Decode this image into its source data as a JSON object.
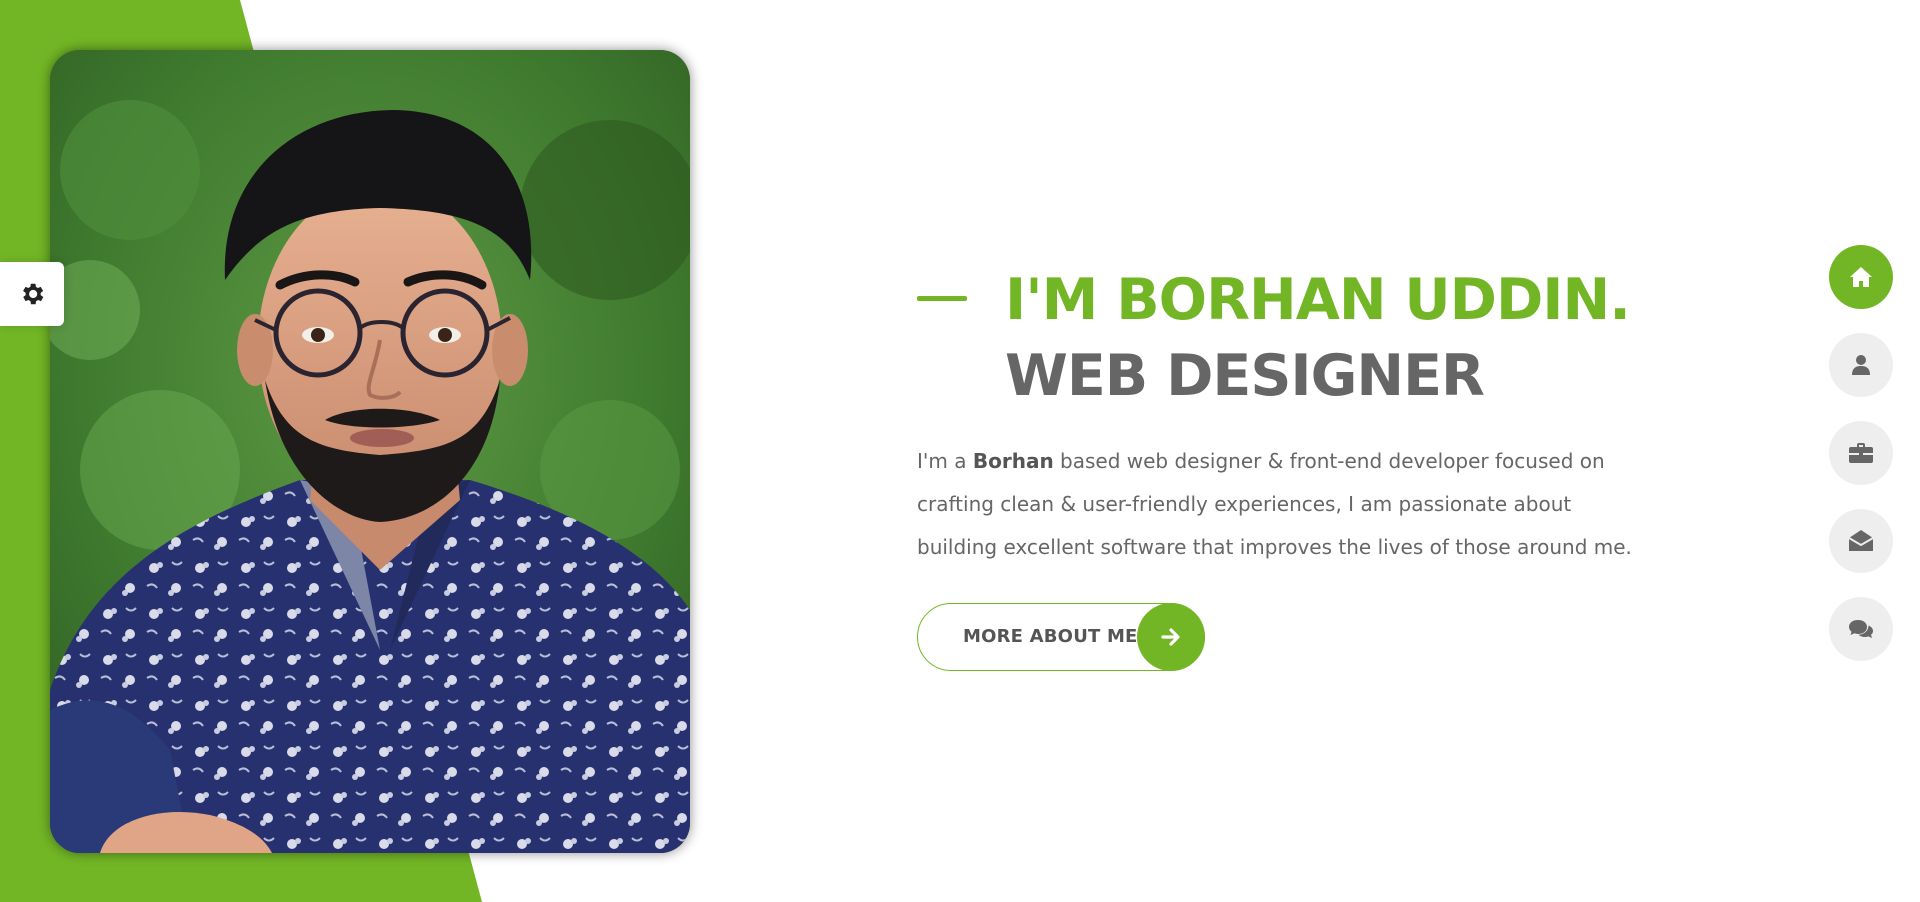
{
  "theme": {
    "accent": "#72b626",
    "heading_gray": "#666666",
    "nav_inactive_bg": "#eeeeee",
    "nav_icon_gray": "#666666"
  },
  "settings_panel": {
    "icon": "gear-icon"
  },
  "profile_photo": {
    "subject": "portrait of a man with glasses wearing a navy floral shirt against green foliage"
  },
  "hero": {
    "title_name": "I'M BORHAN UDDIN.",
    "title_role": "WEB DESIGNER",
    "intro_prefix": "I'm a ",
    "intro_bold": "Borhan",
    "intro_rest": " based web designer & front-end developer focused on crafting clean & user-friendly experiences, I am passionate about building excellent software that improves the lives of those around me.",
    "cta_label": "MORE ABOUT ME",
    "cta_icon": "arrow-right-icon"
  },
  "side_nav": {
    "items": [
      {
        "icon": "home-icon",
        "active": true
      },
      {
        "icon": "user-icon",
        "active": false
      },
      {
        "icon": "briefcase-icon",
        "active": false
      },
      {
        "icon": "envelope-open-icon",
        "active": false
      },
      {
        "icon": "comments-icon",
        "active": false
      }
    ]
  }
}
